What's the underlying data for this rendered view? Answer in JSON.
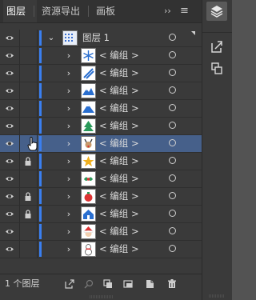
{
  "tabs": [
    {
      "label": "图层",
      "active": true
    },
    {
      "label": "资源导出",
      "active": false
    },
    {
      "label": "画板",
      "active": false
    }
  ],
  "menu": {
    "chevron": "››",
    "burger": "≡"
  },
  "layer": {
    "name": "图层 1",
    "expander": "⌄"
  },
  "sublayer_label": "< 编组 >",
  "rows": [
    {
      "name": "< 编组 >",
      "thumb": "snowflake-icon",
      "locked": false,
      "selected": false
    },
    {
      "name": "< 编组 >",
      "thumb": "skis-icon",
      "locked": false,
      "selected": false
    },
    {
      "name": "< 编组 >",
      "thumb": "mountain-icon",
      "locked": false,
      "selected": false
    },
    {
      "name": "< 编组 >",
      "thumb": "mountain-peak-icon",
      "locked": false,
      "selected": false
    },
    {
      "name": "< 编组 >",
      "thumb": "christmas-tree-icon",
      "locked": false,
      "selected": false
    },
    {
      "name": "< 编组 >",
      "thumb": "reindeer-icon",
      "locked": false,
      "selected": true
    },
    {
      "name": "< 编组 >",
      "thumb": "star-icon",
      "locked": true,
      "selected": false
    },
    {
      "name": "< 编组 >",
      "thumb": "holly-icon",
      "locked": false,
      "selected": false
    },
    {
      "name": "< 编组 >",
      "thumb": "ornament-icon",
      "locked": true,
      "selected": false
    },
    {
      "name": "< 编组 >",
      "thumb": "house-icon",
      "locked": true,
      "selected": false
    },
    {
      "name": "< 编组 >",
      "thumb": "santa-icon",
      "locked": false,
      "selected": false
    },
    {
      "name": "< 编组 >",
      "thumb": "snowman-icon",
      "locked": false,
      "selected": false
    }
  ],
  "footer": {
    "layer_count": "1 个图层"
  },
  "colors": {
    "layer_color": "#3a7ff0",
    "selection": "#46608a",
    "panel_bg": "#3a3a3a"
  }
}
